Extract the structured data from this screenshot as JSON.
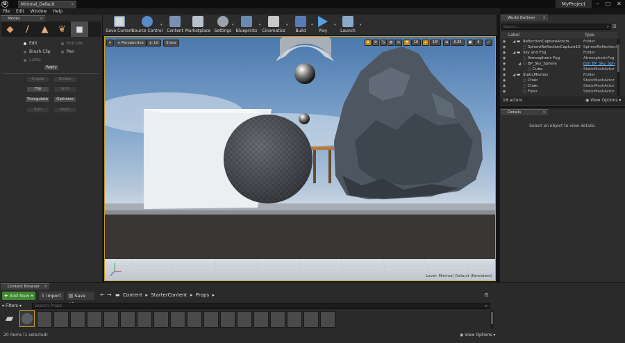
{
  "app": {
    "tab_title": "Minimal_Default",
    "project_name": "MyProject"
  },
  "menu": [
    "File",
    "Edit",
    "Window",
    "Help"
  ],
  "modes": {
    "tab_label": "Modes",
    "radio_left": [
      "Edit",
      "Brush Clip",
      "Lathe"
    ],
    "radio_right": [
      "Extrude",
      "Pen"
    ],
    "apply_label": "Apply",
    "buttons": [
      "Create",
      "Delete",
      "Flip",
      "Split",
      "Triangulate",
      "Optimize",
      "Turn",
      "Weld"
    ]
  },
  "toolbar": {
    "items": [
      "Save Current",
      "Source Control",
      "Content",
      "Marketplace",
      "Settings",
      "Blueprints",
      "Cinematics",
      "Build",
      "Play",
      "Launch"
    ]
  },
  "viewport": {
    "perspective_label": "Perspective",
    "lit_label": "Lit",
    "show_label": "Show",
    "grid_snap": "10",
    "rot_snap": "10°",
    "scale_snap": "0.25",
    "camera_speed": "4",
    "level_text": "Level:  Minimal_Default (Persistent)"
  },
  "world_outliner": {
    "tab_label": "World Outliner",
    "search_placeholder": "Search...",
    "col_label": "Label",
    "col_type": "Type",
    "rows": [
      {
        "label": "ReflectionCaptureActors",
        "type": "Folder"
      },
      {
        "label": "SphereReflectionCapture10",
        "type": "SphereReflectionC"
      },
      {
        "label": "Sky and Fog",
        "type": "Folder"
      },
      {
        "label": "Atmospheric Fog",
        "type": "AtmosphericFog"
      },
      {
        "label": "BP_Sky_Sphere",
        "type": "Edit BP_Sky_Sph"
      },
      {
        "label": "Cube",
        "type": "StaticMeshActor"
      },
      {
        "label": "StaticMeshes",
        "type": "Folder"
      },
      {
        "label": "Chair",
        "type": "StaticMeshActor"
      },
      {
        "label": "Chair",
        "type": "StaticMeshActor"
      },
      {
        "label": "Floor",
        "type": "StaticMeshActor"
      }
    ],
    "actor_count": "18 actors",
    "view_options": "View Options"
  },
  "details": {
    "tab_label": "Details",
    "empty_text": "Select an object to view details."
  },
  "content_browser": {
    "tab_label": "Content Browser",
    "add_new": "Add New",
    "import": "Import",
    "save_all": "Save All",
    "path": [
      "Content",
      "StarterContent",
      "Props"
    ],
    "filters": "Filters",
    "search_placeholder": "Search Props",
    "status": "20 items (1 selected)",
    "view_options": "View Options"
  },
  "colors": {
    "accent": "#c79b22",
    "add_new_green": "#3f8a2f",
    "bp_link": "#6ab6ff"
  }
}
